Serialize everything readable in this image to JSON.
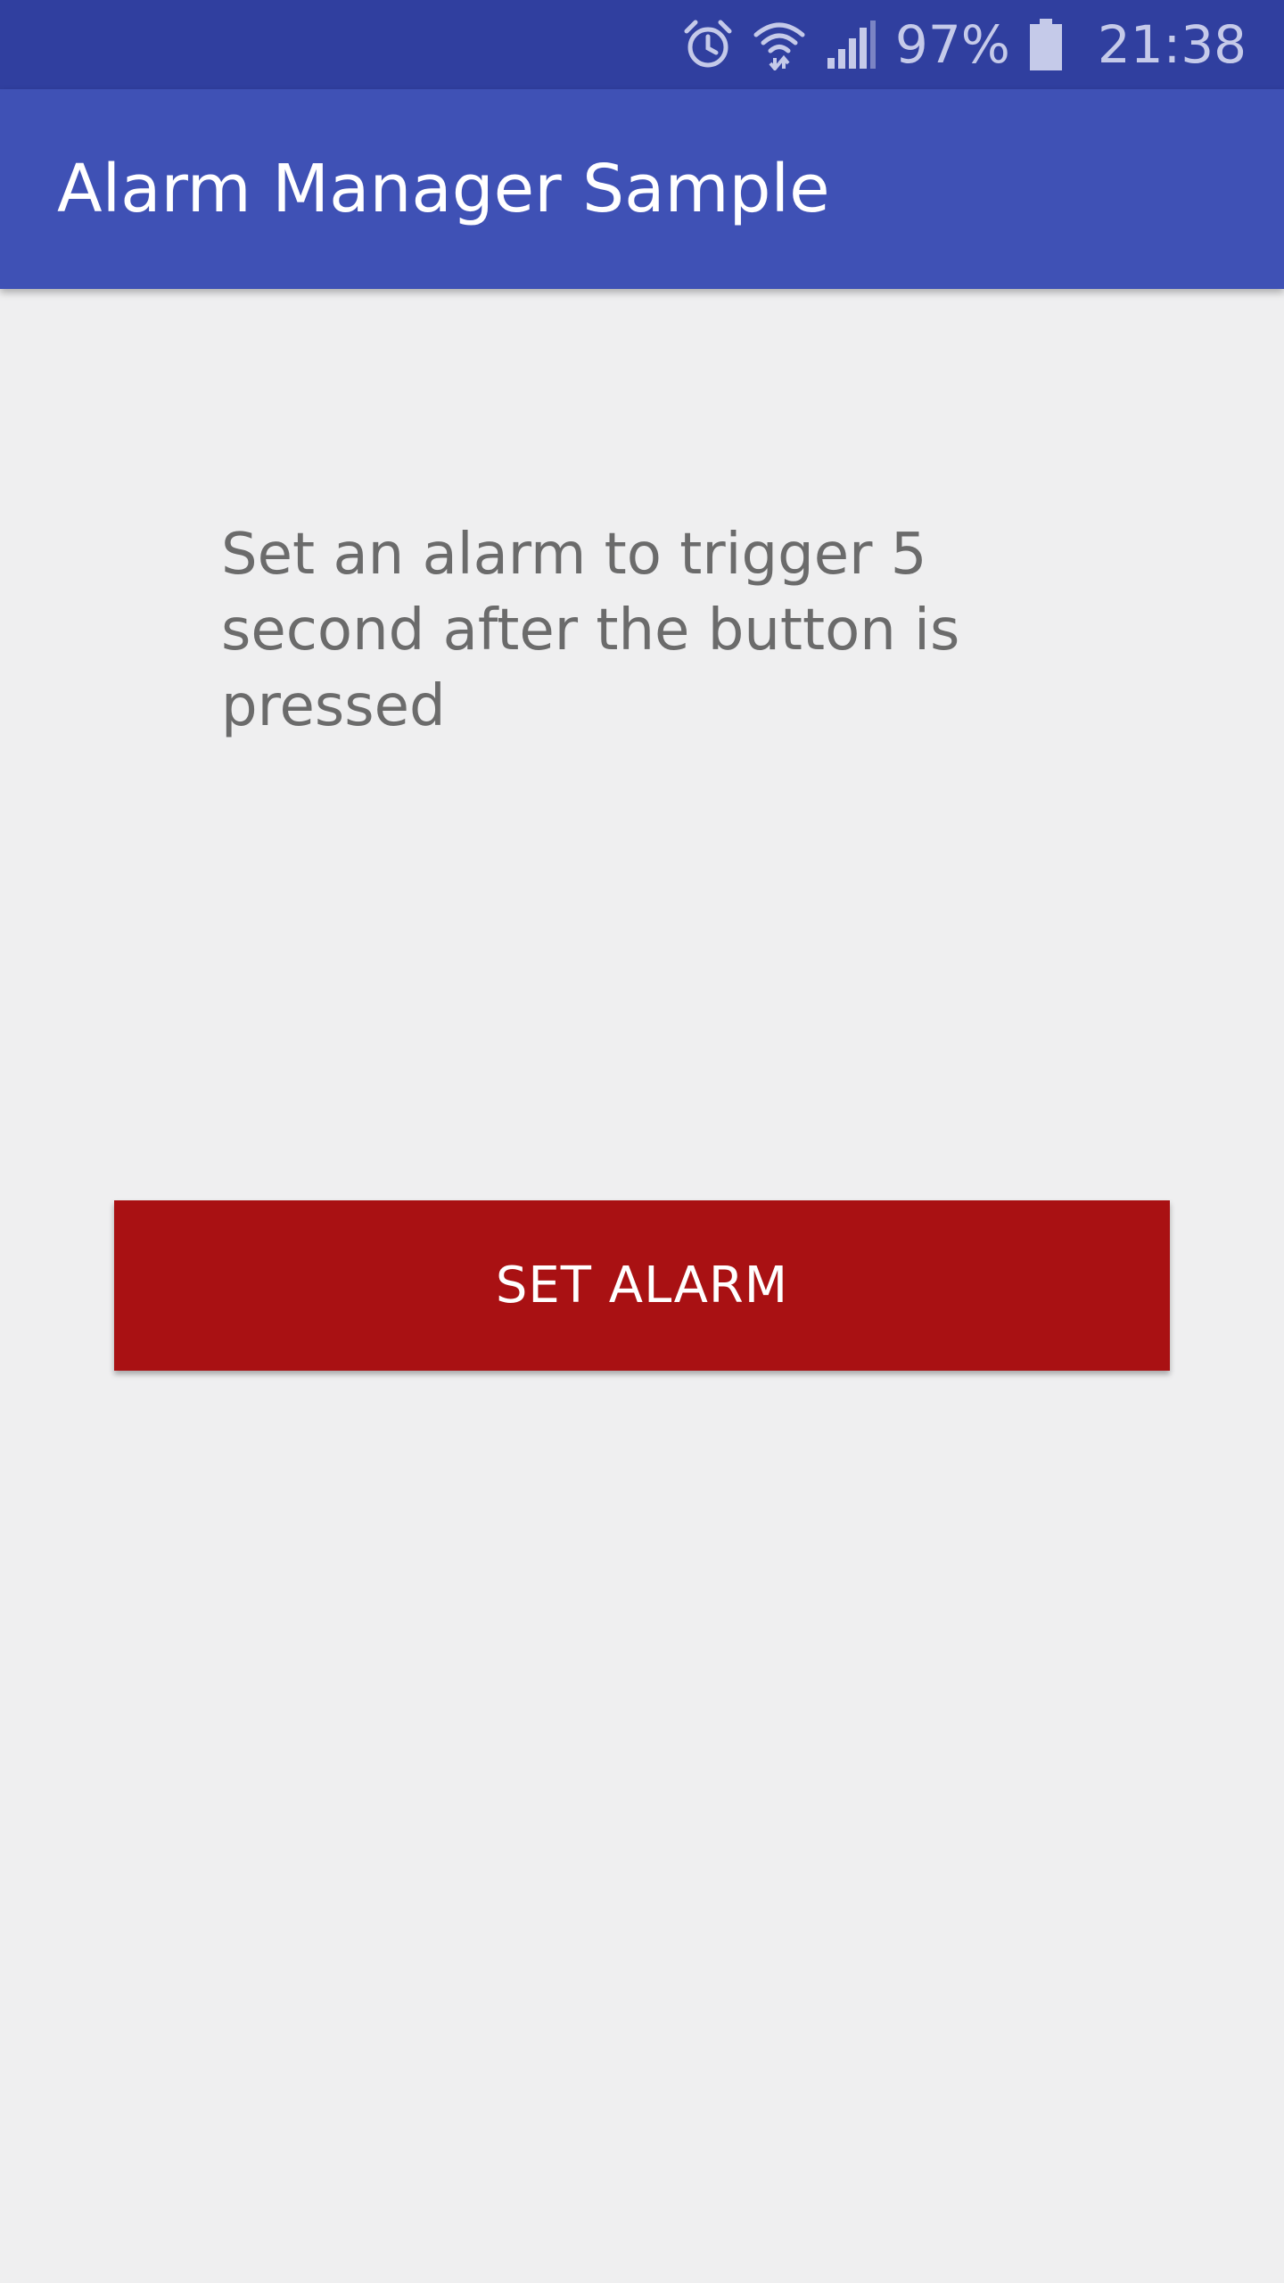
{
  "status_bar": {
    "battery": "97%",
    "time": "21:38",
    "icons": [
      "alarm-clock-icon",
      "wifi-icon",
      "cell-signal-icon",
      "battery-icon"
    ],
    "color": "#303f9f"
  },
  "app_bar": {
    "title": "Alarm Manager Sample",
    "color": "#3f51b5"
  },
  "main": {
    "description": "Set an alarm to trigger 5 second after the button is pressed",
    "button_label": "SET ALARM",
    "button_color": "#a91113"
  }
}
